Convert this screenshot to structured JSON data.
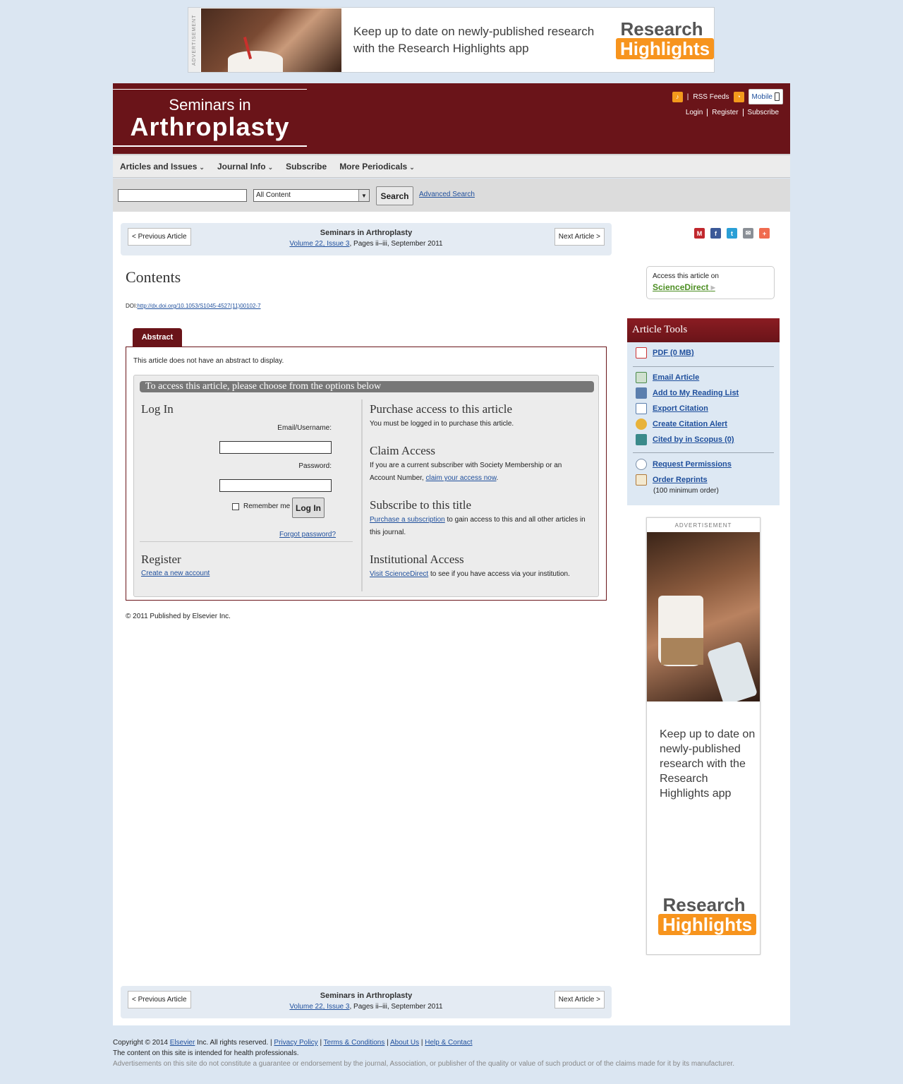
{
  "top_ad": {
    "label": "ADVERTISEMENT",
    "text": "Keep up to date on newly-published research with the Research Highlights app",
    "logo_line1": "Research",
    "logo_line2": "Highlights"
  },
  "masthead": {
    "logo_line1": "Seminars in",
    "logo_line2": "Arthroplasty",
    "rss_label": "RSS Feeds",
    "mobile_label": "Mobile",
    "links": [
      "Login",
      "Register",
      "Subscribe"
    ]
  },
  "nav": {
    "items": [
      "Articles and Issues",
      "Journal Info",
      "Subscribe",
      "More Periodicals"
    ]
  },
  "search": {
    "input_value": "",
    "select_value": "All Content",
    "button_label": "Search",
    "advanced_label": "Advanced Search"
  },
  "article_nav": {
    "prev_label": "< Previous Article",
    "next_label": "Next Article >",
    "journal_title": "Seminars in Arthroplasty",
    "volume_link": "Volume 22, Issue 3",
    "pages_text": ", Pages ii–iii, September 2011"
  },
  "article": {
    "title": "Contents",
    "doi_label": "DOI:",
    "doi_link": "http://dx.doi.org/10.1053/S1045-4527(11)00102-7",
    "tab_label": "Abstract",
    "no_abstract": "This article does not have an abstract to display.",
    "copyright": "© 2011 Published by Elsevier Inc."
  },
  "access": {
    "bar_text": "To access this article, please choose from the options below",
    "login": {
      "heading": "Log In",
      "email_label": "Email/Username:",
      "email_value": "",
      "password_label": "Password:",
      "password_value": "",
      "remember_label": "Remember me",
      "button_label": "Log In",
      "forgot_label": "Forgot password?"
    },
    "register": {
      "heading": "Register",
      "link": "Create a new account"
    },
    "purchase": {
      "heading": "Purchase access to this article",
      "text": "You must be logged in to purchase this article."
    },
    "claim": {
      "heading": "Claim Access",
      "text_before": "If you are a current subscriber with Society Membership or an Account Number, ",
      "link": "claim your access now",
      "text_after": "."
    },
    "subscribe": {
      "heading": "Subscribe to this title",
      "link": "Purchase a subscription",
      "text": " to gain access to this and all other articles in this journal."
    },
    "institutional": {
      "heading": "Institutional Access",
      "link": "Visit ScienceDirect",
      "text": " to see if you have access via your institution."
    }
  },
  "sciencedirect_box": {
    "label": "Access this article on",
    "link": "ScienceDirect"
  },
  "article_tools": {
    "heading": "Article Tools",
    "pdf": "PDF (0 MB)",
    "email": "Email Article",
    "reading_list": "Add to My Reading List",
    "export": "Export Citation",
    "alert": "Create Citation Alert",
    "scopus": "Cited by in Scopus (0)",
    "permissions": "Request Permissions",
    "reprints": "Order Reprints",
    "reprints_note": "(100 minimum order)"
  },
  "side_ad": {
    "label": "ADVERTISEMENT",
    "text": "Keep up to date on newly-published research with the Research Highlights app",
    "logo_line1": "Research",
    "logo_line2": "Highlights"
  },
  "footer": {
    "copyright_prefix": "Copyright © 2014 ",
    "elsevier_link": "Elsevier",
    "rights_text": " Inc. All rights reserved. | ",
    "links": [
      "Privacy Policy",
      "Terms & Conditions",
      "About Us",
      "Help & Contact"
    ],
    "line2": "The content on this site is intended for health professionals.",
    "line3": "Advertisements on this site do not constitute a guarantee or endorsement by the journal, Association, or publisher of the quality or value of such product or of the claims made for it by its manufacturer."
  },
  "colors": {
    "brand": "#6a1419",
    "page_bg": "#dbe6f2",
    "link": "#1f4f9c",
    "sciencedirect": "#4c8e22",
    "rh_orange": "#f7941d"
  }
}
